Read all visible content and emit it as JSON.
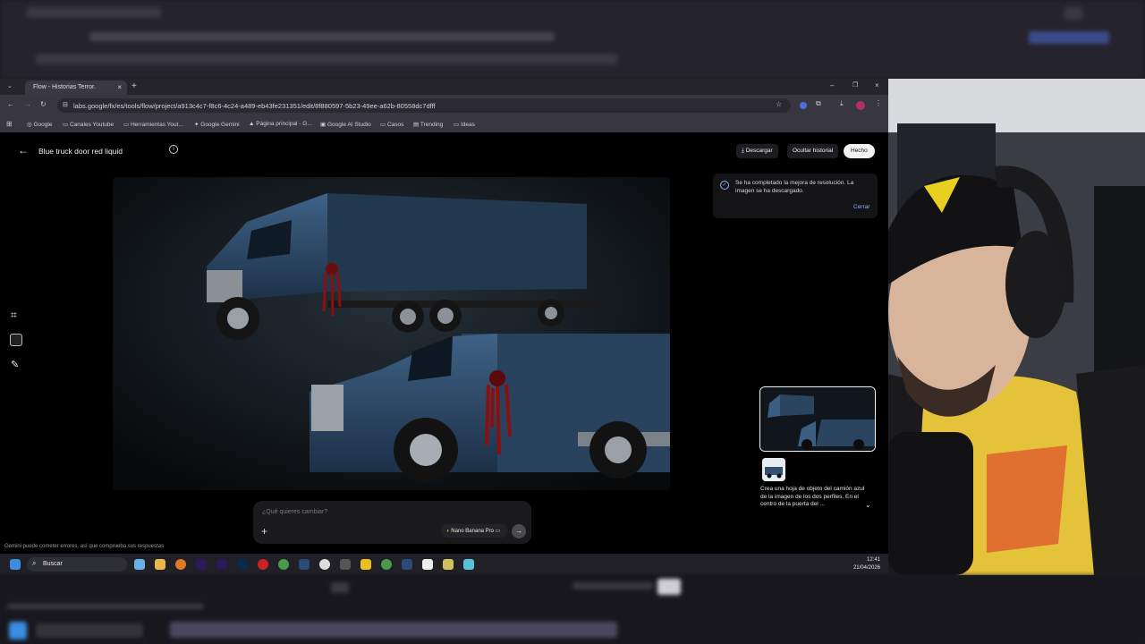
{
  "browser": {
    "tab_title": "Flow - Historias Terror.",
    "url": "labs.google/fx/es/tools/flow/project/a913c4c7-f8c6-4c24-a489-eb43fe231351/edit/8f880597-5b23-49ee-a62b-80558dc7dfff"
  },
  "bookmarks": [
    {
      "label": "Google",
      "icon": "google-icon"
    },
    {
      "label": "Canales Youtube",
      "icon": "folder-icon"
    },
    {
      "label": "Herramientas Yout...",
      "icon": "folder-icon"
    },
    {
      "label": "Google Gemini",
      "icon": "gemini-icon"
    },
    {
      "label": "Página principal - G...",
      "icon": "drive-icon"
    },
    {
      "label": "Google AI Studio",
      "icon": "aistudio-icon"
    },
    {
      "label": "Casos",
      "icon": "folder-icon"
    },
    {
      "label": "Trending",
      "icon": "trending-icon"
    },
    {
      "label": "Ideas",
      "icon": "folder-icon"
    }
  ],
  "app": {
    "title": "Blue truck door red liquid",
    "download_label": "Descargar",
    "hide_history_label": "Ocultar historial",
    "done_label": "Hecho"
  },
  "toast": {
    "message": "Se ha completado la mejora de resolución. La imagen se ha descargado.",
    "close_label": "Cerrar"
  },
  "history": {
    "caption": "Crea una hoja de objeto del camión azul de la imagen de los dos perfiles. En el centro de la puerta del ..."
  },
  "prompt": {
    "placeholder": "¿Qué quieres cambiar?",
    "model_label": "Nano Banana Pro"
  },
  "disclaimer": "Gemini puede cometer errores, así que comprueba sus respuestas",
  "taskbar": {
    "search_label": "Buscar",
    "time": "12:41",
    "date": "21/04/2026"
  }
}
